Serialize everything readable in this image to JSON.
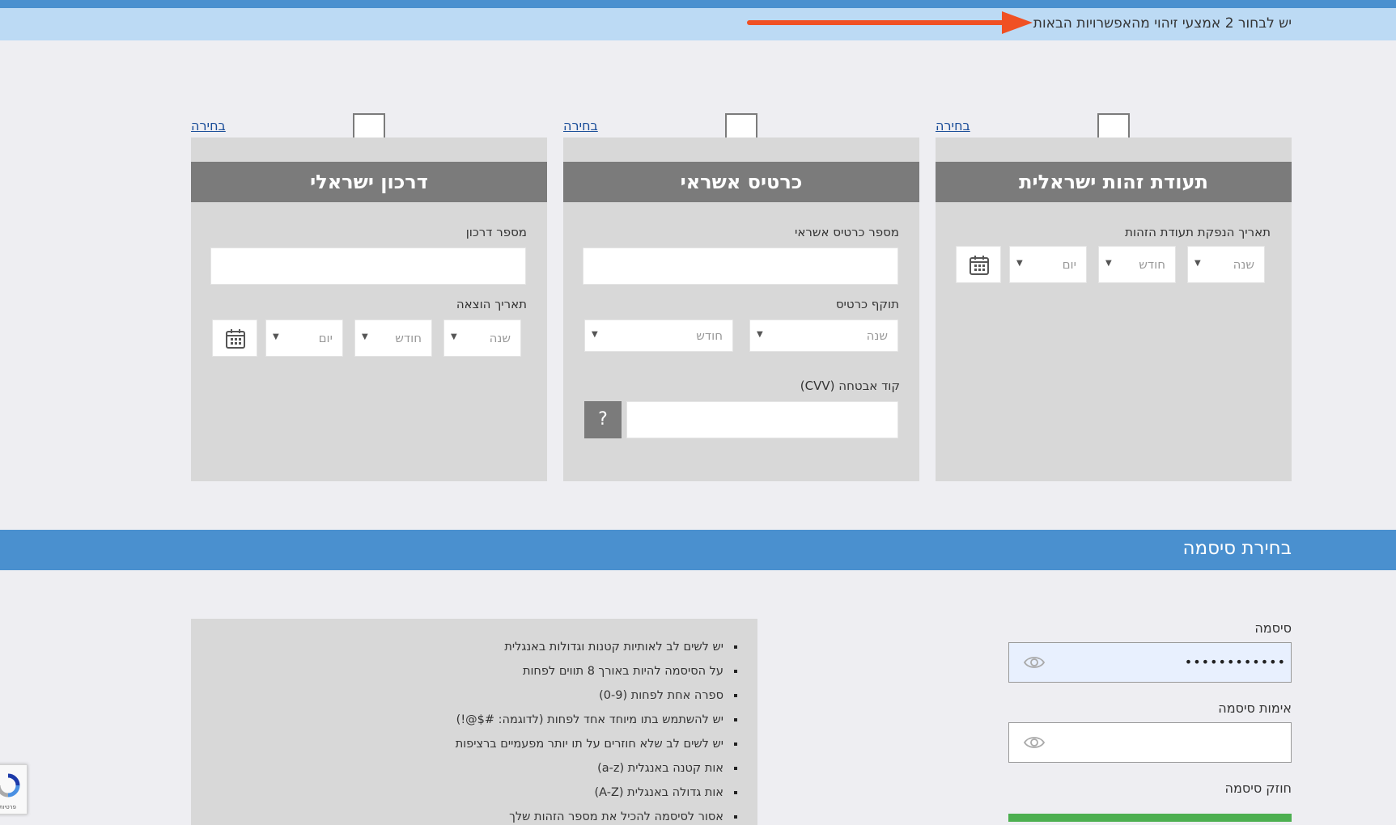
{
  "notice": {
    "text": "יש לבחור 2 אמצעי זיהוי מהאפשרויות הבאות"
  },
  "colors": {
    "accent": "#4a90cf",
    "notice_bg": "#bcdaf4",
    "arrow": "#f05023",
    "card_head": "#7b7b7b",
    "strength": "#4caf50"
  },
  "cards": {
    "id": {
      "title": "תעודת זהות ישראלית",
      "select_label": "בחירה",
      "date_label": "תאריך הנפקת תעודת הזהות",
      "year": "שנה",
      "month": "חודש",
      "day": "יום"
    },
    "credit": {
      "title": "כרטיס אשראי",
      "select_label": "בחירה",
      "number_label": "מספר כרטיס אשראי",
      "validity_label": "תוקף כרטיס",
      "year": "שנה",
      "month": "חודש",
      "cvv_label": "קוד אבטחה (CVV)",
      "help": "?"
    },
    "passport": {
      "title": "דרכון ישראלי",
      "select_label": "בחירה",
      "number_label": "מספר דרכון",
      "issue_label": "תאריך הוצאה",
      "year": "שנה",
      "month": "חודש",
      "day": "יום"
    }
  },
  "password": {
    "section_title": "בחירת סיסמה",
    "password_label": "סיסמה",
    "password_value": "••••••••••••",
    "confirm_label": "אימות סיסמה",
    "strength_label": "חוזק סיסמה",
    "rules": [
      "יש לשים לב לאותיות קטנות וגדולות באנגלית",
      "על הסיסמה להיות באורך 8 תווים לפחות",
      "ספרה אחת לפחות (0-9)",
      "יש להשתמש בתו מיוחד אחד לפחות (לדוגמה: #$@!)",
      "יש לשים לב שלא חוזרים על תו יותר מפעמיים ברציפות",
      "אות קטנה באנגלית (a-z)",
      "אות גדולה באנגלית (A-Z)",
      "אסור לסיסמה להכיל את מספר הזהות שלך"
    ]
  },
  "recaptcha": {
    "text": "פרטיות"
  }
}
